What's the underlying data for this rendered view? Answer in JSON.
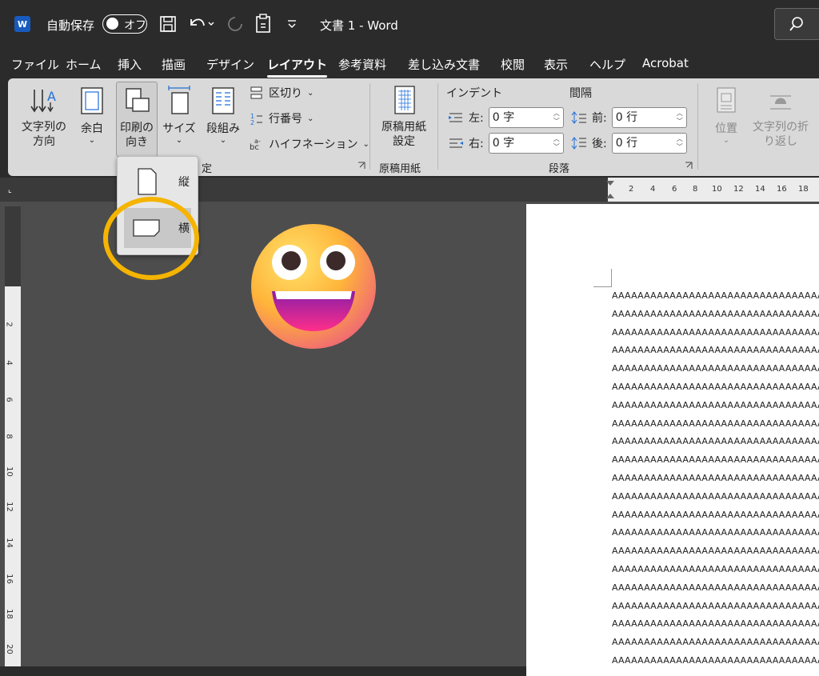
{
  "titlebar": {
    "app_logo": "W",
    "autosave_label": "自動保存",
    "autosave_state": "オフ",
    "doc_title": "文書 1 - Word"
  },
  "tabs": [
    "ファイル",
    "ホーム",
    "挿入",
    "描画",
    "デザイン",
    "レイアウト",
    "参考資料",
    "差し込み文書",
    "校閲",
    "表示",
    "ヘルプ",
    "Acrobat"
  ],
  "active_tab": "レイアウト",
  "ribbon": {
    "text_direction": "文字列の\n方向",
    "margins": "余白",
    "orientation": "印刷の\n向き",
    "size": "サイズ",
    "columns": "段組み",
    "breaks": "区切り",
    "line_numbers": "行番号",
    "hyphenation": "ハイフネーション",
    "page_setup_group_partial": "定",
    "genkou_button": "原稿用紙\n設定",
    "genkou_group": "原稿用紙",
    "indent_label": "インデント",
    "spacing_label": "間隔",
    "indent_left_label": "左:",
    "indent_left_value": "0 字",
    "indent_right_label": "右:",
    "indent_right_value": "0 字",
    "spacing_before_label": "前:",
    "spacing_before_value": "0 行",
    "spacing_after_label": "後:",
    "spacing_after_value": "0 行",
    "paragraph_group": "段落",
    "position": "位置",
    "wrap_text": "文字列の折\nり返し"
  },
  "orientation_menu": {
    "portrait": "縦",
    "landscape": "横"
  },
  "ruler_h": [
    "2",
    "4",
    "6",
    "8",
    "10",
    "12",
    "14",
    "16",
    "18"
  ],
  "ruler_v": [
    "2",
    "4",
    "6",
    "8",
    "10",
    "12",
    "14",
    "16",
    "18",
    "20"
  ],
  "document_line": "AAAAAAAAAAAAAAAAAAAAAAAAAAAAAAAAAAAA",
  "document_line_count": 21,
  "colors": {
    "highlight": "#f5b400",
    "word_blue": "#185abd"
  },
  "icons": [
    "word-logo-icon",
    "save-icon",
    "undo-icon",
    "redo-icon",
    "touch-mode-icon",
    "customize-icon",
    "search-icon",
    "emoji-grinning-icon"
  ]
}
